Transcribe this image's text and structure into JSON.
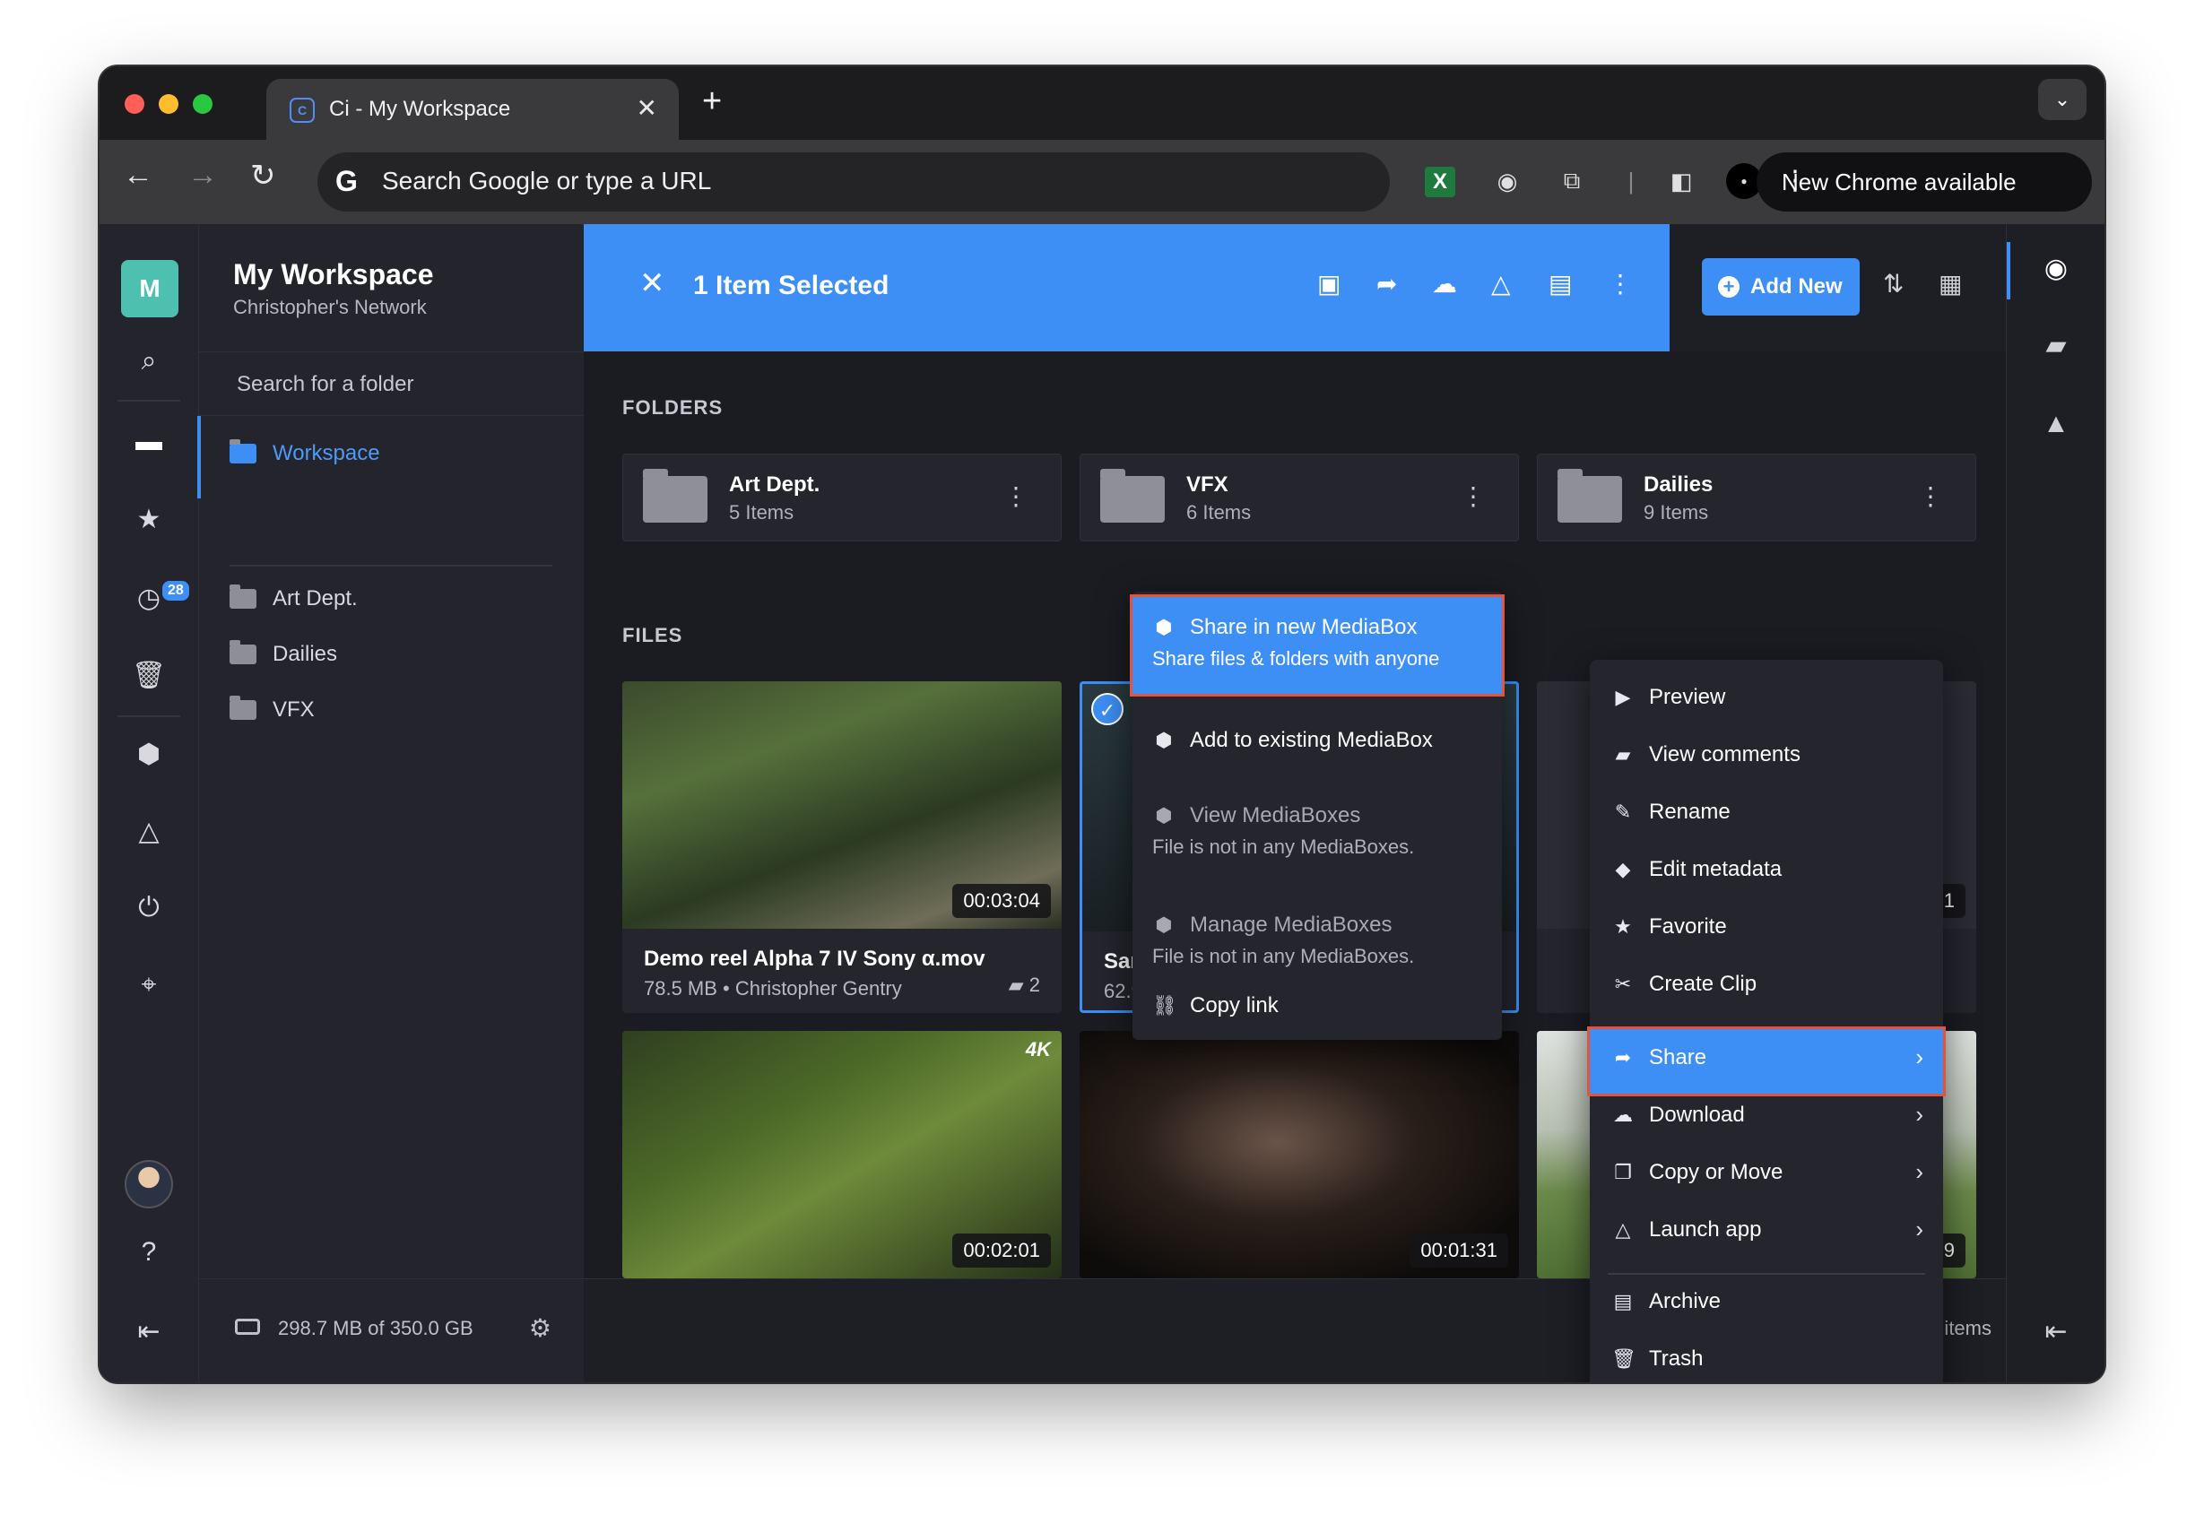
{
  "browser": {
    "tab_title": "Ci - My Workspace",
    "tab_close": "✕",
    "new_tab": "+",
    "omnibox_placeholder": "Search Google or type a URL",
    "new_chrome": "New Chrome available"
  },
  "sidebar": {
    "workspace_letter": "M",
    "workspace_title": "My Workspace",
    "workspace_subtitle": "Christopher's Network",
    "search_placeholder": "Search for a folder",
    "active_item": "Workspace",
    "tree": [
      "Art Dept.",
      "Dailies",
      "VFX"
    ],
    "recent_badge": "28",
    "storage": "298.7 MB of 350.0 GB"
  },
  "selection_bar": {
    "label": "1 Item Selected",
    "close": "✕"
  },
  "top_right": {
    "add_new": "Add New"
  },
  "sections": {
    "folders": "FOLDERS",
    "files": "FILES"
  },
  "folders": [
    {
      "name": "Art Dept.",
      "count": "5 Items"
    },
    {
      "name": "VFX",
      "count": "6 Items"
    },
    {
      "name": "Dailies",
      "count": "9 Items"
    }
  ],
  "files": [
    {
      "name": "Demo reel Alpha 7 IV Sony α.mov",
      "sub": "78.5 MB • Christopher Gentry",
      "comments": "2",
      "duration": "00:03:04"
    },
    {
      "name": "San",
      "sub": "62.9",
      "duration": "00:01:31"
    },
    {
      "name": "",
      "sub": "",
      "duration": "00:02:51"
    },
    {
      "duration": "00:02:01"
    },
    {
      "duration": "00:01:31"
    },
    {
      "duration": "00:00:09"
    }
  ],
  "footer": {
    "count": "11 items"
  },
  "share_submenu": {
    "new_mediabox": "Share in new MediaBox",
    "new_mediabox_sub": "Share files & folders with anyone",
    "add_existing": "Add to existing MediaBox",
    "view_mediaboxes": "View MediaBoxes",
    "view_sub": "File is not in any MediaBoxes.",
    "manage_mediaboxes": "Manage MediaBoxes",
    "manage_sub": "File is not in any MediaBoxes.",
    "copy_link": "Copy link"
  },
  "context_menu": {
    "preview": "Preview",
    "view_comments": "View comments",
    "rename": "Rename",
    "edit_metadata": "Edit metadata",
    "favorite": "Favorite",
    "create_clip": "Create Clip",
    "share": "Share",
    "download": "Download",
    "copy_move": "Copy or Move",
    "launch_app": "Launch app",
    "archive": "Archive",
    "trash": "Trash"
  },
  "colors": {
    "accent": "#3d8ef5",
    "highlight_outline": "#e5533d",
    "workspace_avatar": "#4ec0b0"
  }
}
